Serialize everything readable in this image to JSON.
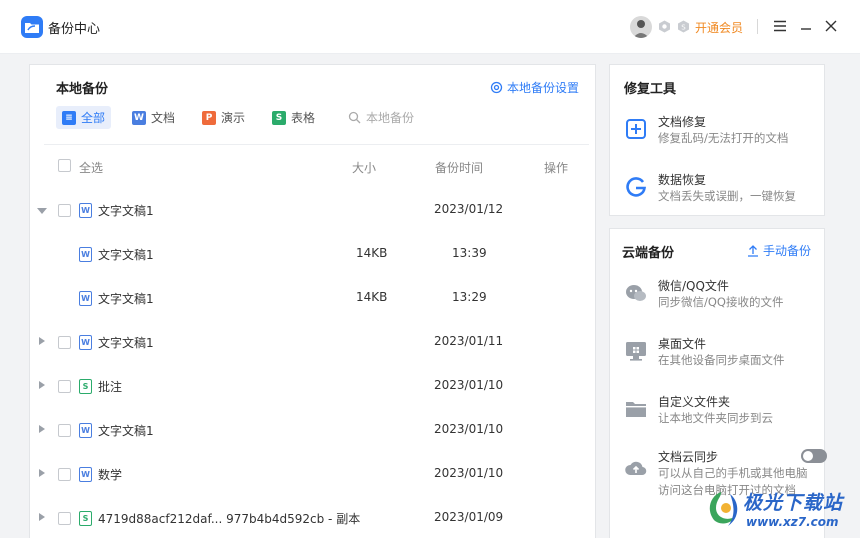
{
  "app": {
    "title": "备份中心",
    "vip_label": "开通会员"
  },
  "local_backup": {
    "title": "本地备份",
    "settings_label": "本地备份设置",
    "tabs": [
      {
        "label": "全部",
        "icon": "list-icon",
        "active": true
      },
      {
        "label": "文档",
        "icon": "word-doc-icon",
        "color": "#4a7ee0",
        "glyph": "W"
      },
      {
        "label": "演示",
        "icon": "presentation-icon",
        "color": "#ef6b3b",
        "glyph": "P"
      },
      {
        "label": "表格",
        "icon": "spreadsheet-icon",
        "color": "#2bab6b",
        "glyph": "S"
      },
      {
        "label": "本地备份",
        "icon": "search-icon"
      }
    ],
    "columns": {
      "select_all": "全选",
      "size": "大小",
      "time": "备份时间",
      "action": "操作"
    },
    "rows": [
      {
        "name": "文字文稿1",
        "type": "W",
        "size": "",
        "time": "2023/01/12",
        "level": 0,
        "expanded": true
      },
      {
        "name": "文字文稿1",
        "type": "W",
        "size": "14KB",
        "time": "13:39",
        "level": 1
      },
      {
        "name": "文字文稿1",
        "type": "W",
        "size": "14KB",
        "time": "13:29",
        "level": 1
      },
      {
        "name": "文字文稿1",
        "type": "W",
        "size": "",
        "time": "2023/01/11",
        "level": 0,
        "expanded": false
      },
      {
        "name": "批注",
        "type": "S",
        "size": "",
        "time": "2023/01/10",
        "level": 0,
        "expanded": false
      },
      {
        "name": "文字文稿1",
        "type": "W",
        "size": "",
        "time": "2023/01/10",
        "level": 0,
        "expanded": false
      },
      {
        "name": "数学",
        "type": "W",
        "size": "",
        "time": "2023/01/10",
        "level": 0,
        "expanded": false
      },
      {
        "name": "4719d88acf212daf... 977b4b4d592cb - 副本",
        "type": "S",
        "size": "",
        "time": "2023/01/09",
        "level": 0,
        "expanded": false
      }
    ]
  },
  "repair_tools": {
    "title": "修复工具",
    "items": [
      {
        "title": "文档修复",
        "desc": "修复乱码/无法打开的文档",
        "icon": "doc-repair-icon"
      },
      {
        "title": "数据恢复",
        "desc": "文档丢失或误删，一键恢复",
        "icon": "data-recovery-icon"
      }
    ]
  },
  "cloud_backup": {
    "title": "云端备份",
    "manual_label": "手动备份",
    "items": [
      {
        "title": "微信/QQ文件",
        "desc": "同步微信/QQ接收的文件",
        "icon": "chat-icon"
      },
      {
        "title": "桌面文件",
        "desc": "在其他设备同步桌面文件",
        "icon": "desktop-icon"
      },
      {
        "title": "自定义文件夹",
        "desc": "让本地文件夹同步到云",
        "icon": "folder-icon"
      },
      {
        "title": "文档云同步",
        "desc": "可以从自己的手机或其他电脑",
        "desc2": "访问这台电脑打开过的文档",
        "icon": "cloud-upload-icon",
        "toggle": false
      }
    ]
  },
  "watermark": {
    "line1": "极光下载站",
    "line2": "www.xz7.com"
  },
  "colors": {
    "accent": "#2f7cf6",
    "vip": "#f08a24"
  }
}
